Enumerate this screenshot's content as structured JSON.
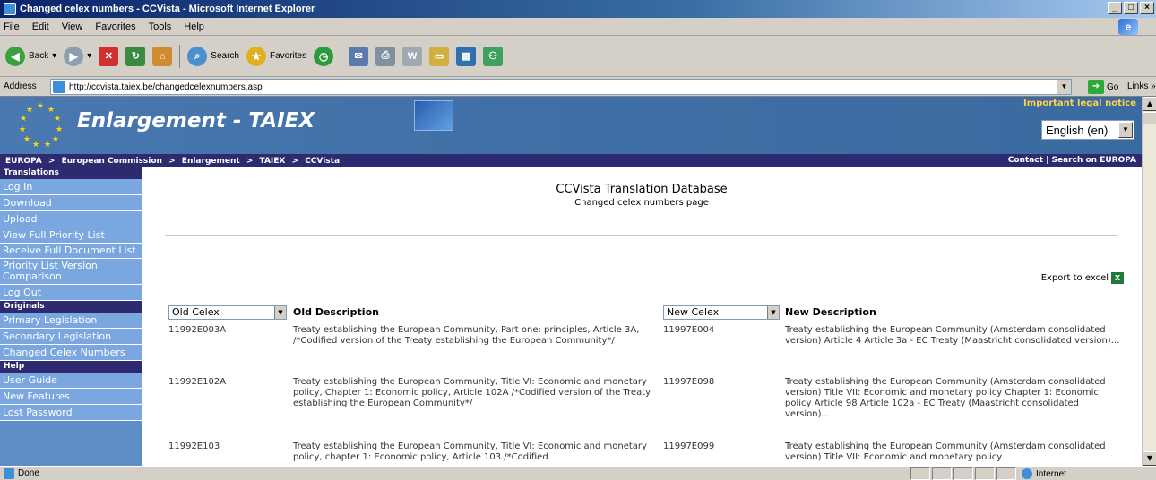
{
  "window": {
    "title": "Changed celex numbers - CCVista - Microsoft Internet Explorer",
    "minimize": "_",
    "maximize": "□",
    "close": "×"
  },
  "menu": [
    "File",
    "Edit",
    "View",
    "Favorites",
    "Tools",
    "Help"
  ],
  "toolbar": {
    "back": "Back",
    "search": "Search",
    "favorites": "Favorites"
  },
  "address": {
    "label": "Address",
    "url": "http://ccvista.taiex.be/changedcelexnumbers.asp",
    "go": "Go",
    "links": "Links »"
  },
  "banner": {
    "title": "Enlargement - TAIEX",
    "legal_notice": "Important legal notice",
    "language": "English (en)"
  },
  "breadcrumb": {
    "items": [
      "EUROPA",
      ">",
      "European Commission",
      ">",
      "Enlargement",
      ">",
      "TAIEX",
      ">",
      "CCVista"
    ],
    "contact": "Contact",
    "separator": "|",
    "search": "Search on EUROPA"
  },
  "sidebar": {
    "translations_header": "Translations",
    "translations": [
      "Log In",
      "Download",
      "Upload",
      "View Full Priority List",
      "Receive Full Document List",
      "Priority List Version Comparison",
      "Log Out"
    ],
    "originals_header": "Originals",
    "originals": [
      "Primary Legislation",
      "Secondary Legislation",
      "Changed Celex Numbers"
    ],
    "help_header": "Help",
    "help": [
      "User Guide",
      "New Features",
      "Lost Password"
    ]
  },
  "main": {
    "title": "CCVista Translation Database",
    "subtitle": "Changed celex numbers page",
    "export": "Export to excel",
    "old_celex_select": "Old Celex",
    "old_desc_header": "Old Description",
    "new_celex_select": "New Celex",
    "new_desc_header": "New Description",
    "rows": [
      {
        "old_celex": "11992E003A",
        "old_desc": "Treaty establishing the European Community, Part one: principles, Article 3A, /*Codified version of the Treaty establishing the European Community*/",
        "new_celex": "11997E004",
        "new_desc": "Treaty establishing the European Community (Amsterdam consolidated version) Article 4 Article 3a - EC Treaty (Maastricht consolidated version)..."
      },
      {
        "old_celex": "11992E102A",
        "old_desc": "Treaty establishing the European Community, Title VI: Economic and monetary policy, Chapter 1: Economic policy, Article 102A /*Codified version of the Treaty establishing the European Community*/",
        "new_celex": "11997E098",
        "new_desc": "Treaty establishing the European Community (Amsterdam consolidated version) Title VII: Economic and monetary policy Chapter 1: Economic policy Article 98 Article 102a - EC Treaty (Maastricht consolidated version)..."
      },
      {
        "old_celex": "11992E103",
        "old_desc": "Treaty establishing the European Community, Title VI: Economic and monetary policy, chapter 1: Economic policy, Article 103 /*Codified",
        "new_celex": "11997E099",
        "new_desc": "Treaty establishing the European Community (Amsterdam consolidated version) Title VII: Economic and monetary policy"
      }
    ]
  },
  "status": {
    "text": "Done",
    "zone": "Internet"
  }
}
